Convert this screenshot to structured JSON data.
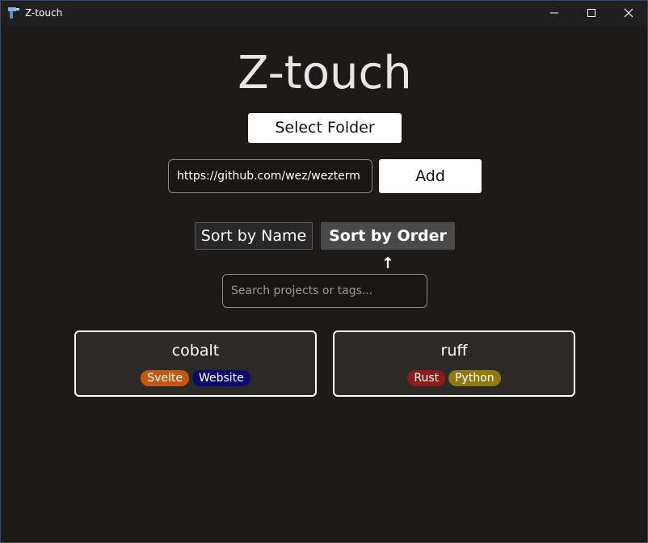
{
  "window": {
    "title": "Z-touch",
    "controls": {
      "minimize": "minimize-icon",
      "maximize": "maximize-icon",
      "close": "close-icon"
    }
  },
  "header": {
    "title": "Z-touch"
  },
  "select_folder": {
    "label": "Select Folder"
  },
  "add_repo": {
    "value": "https://github.com/wez/wezterm",
    "button_label": "Add"
  },
  "sort": {
    "by_name_label": "Sort by Name",
    "by_order_label": "Sort by Order ↑",
    "active": "order"
  },
  "search": {
    "placeholder": "Search projects or tags..."
  },
  "projects": [
    {
      "name": "cobalt",
      "tags": [
        {
          "label": "Svelte",
          "color": "#c05a12"
        },
        {
          "label": "Website",
          "color": "#0b0b6e"
        }
      ]
    },
    {
      "name": "ruff",
      "tags": [
        {
          "label": "Rust",
          "color": "#8b1c1c"
        },
        {
          "label": "Python",
          "color": "#8f7a10"
        }
      ]
    }
  ],
  "colors": {
    "background": "#1e1a18",
    "card": "#2d2927",
    "accent": "#ffffff"
  }
}
